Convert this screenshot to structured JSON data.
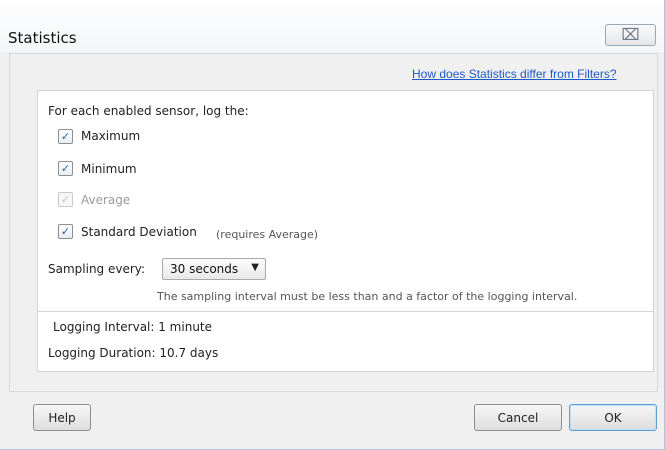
{
  "dialog": {
    "title": "Statistics",
    "close_glyph": "⌧"
  },
  "help_link": "How does Statistics differ from Filters?",
  "panel": {
    "heading": "For each enabled sensor, log the:",
    "options": [
      {
        "label": "Maximum",
        "checked": true,
        "enabled": true
      },
      {
        "label": "Minimum",
        "checked": true,
        "enabled": true
      },
      {
        "label": "Average",
        "checked": true,
        "enabled": false
      },
      {
        "label": "Standard Deviation",
        "checked": true,
        "enabled": true
      }
    ],
    "std_note": "(requires Average)",
    "check_glyph": "✓",
    "sampling_label": "Sampling every:",
    "sampling_value": "30 seconds",
    "dropdown_arrow": "▼",
    "sampling_hint": "The sampling interval must be less than and a factor of the logging interval.",
    "logging_interval": "Logging Interval: 1 minute",
    "logging_duration": "Logging Duration: 10.7 days"
  },
  "buttons": {
    "help": "Help",
    "cancel": "Cancel",
    "ok": "OK"
  },
  "colors": {
    "link": "#1e5ac8",
    "check": "#2a5fa6"
  }
}
